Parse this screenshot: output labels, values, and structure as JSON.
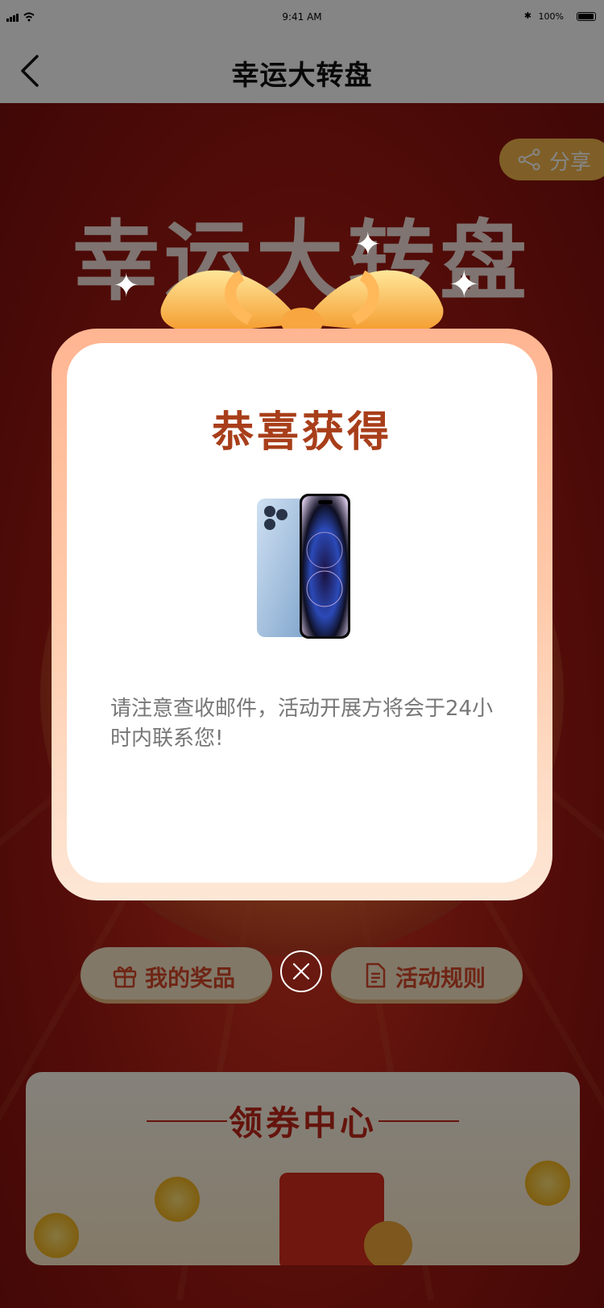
{
  "status_bar": {
    "time": "9:41 AM",
    "battery": "100%"
  },
  "nav": {
    "title": "幸运大转盘"
  },
  "page": {
    "big_title": "幸运大转盘",
    "share_label": "分享",
    "my_prizes_label": "我的奖品",
    "rules_label": "活动规则",
    "coupon_center_title": "领券中心"
  },
  "modal": {
    "title": "恭喜获得",
    "message": "请注意查收邮件，活动开展方将会于24小时内联系您!"
  },
  "colors": {
    "modal_title": "#a83e1a",
    "modal_frame_top": "#ffb592",
    "modal_frame_bottom": "#fde7d6",
    "scene_red": "#c22a1a"
  }
}
